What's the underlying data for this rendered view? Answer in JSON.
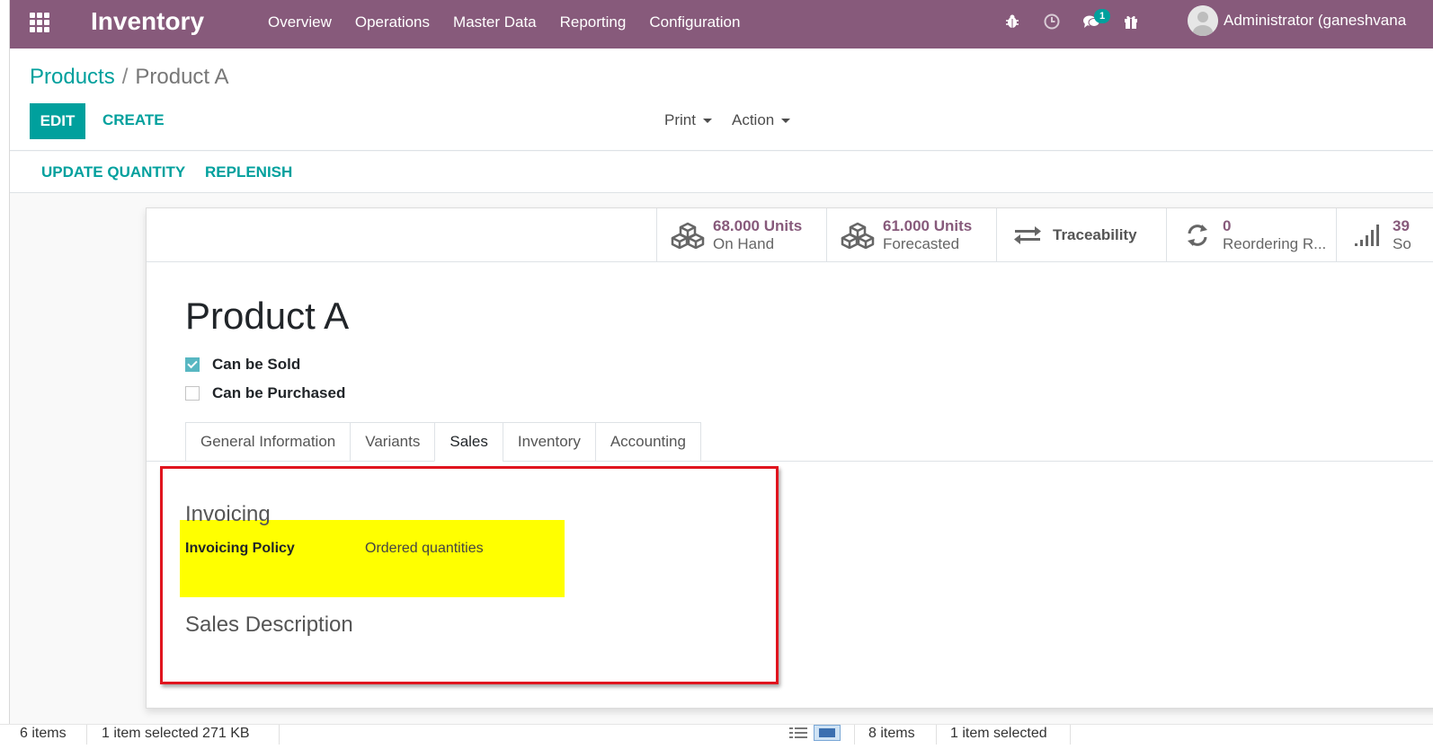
{
  "navbar": {
    "app_name": "Inventory",
    "menu": [
      "Overview",
      "Operations",
      "Master Data",
      "Reporting",
      "Configuration"
    ],
    "chat_badge": "1",
    "user_name": "Administrator (ganeshvana",
    "color": "#875a7b"
  },
  "breadcrumb": {
    "parent": "Products",
    "separator": "/",
    "current": "Product A"
  },
  "toolbar": {
    "edit_label": "EDIT",
    "create_label": "CREATE",
    "print_label": "Print",
    "action_label": "Action"
  },
  "statusbar": {
    "update_quantity_label": "UPDATE QUANTITY",
    "replenish_label": "REPLENISH"
  },
  "smart_buttons": {
    "on_hand": {
      "value": "68.000 Units",
      "label": "On Hand",
      "icon": "cubes-icon"
    },
    "forecasted": {
      "value": "61.000 Units",
      "label": "Forecasted",
      "icon": "cubes-icon"
    },
    "traceability": {
      "label": "Traceability",
      "icon": "exchange-icon"
    },
    "reordering": {
      "value": "0",
      "label": "Reordering R...",
      "icon": "refresh-icon"
    },
    "sold": {
      "value": "39",
      "label": "So",
      "icon": "signal-icon"
    }
  },
  "product": {
    "name": "Product A",
    "can_be_sold_label": "Can be Sold",
    "can_be_sold": true,
    "can_be_purchased_label": "Can be Purchased",
    "can_be_purchased": false
  },
  "tabs": [
    {
      "label": "General Information",
      "active": false
    },
    {
      "label": "Variants",
      "active": false
    },
    {
      "label": "Sales",
      "active": true
    },
    {
      "label": "Inventory",
      "active": false
    },
    {
      "label": "Accounting",
      "active": false
    }
  ],
  "sales_tab": {
    "invoicing_title": "Invoicing",
    "invoicing_policy_label": "Invoicing Policy",
    "invoicing_policy_value": "Ordered quantities",
    "sales_description_title": "Sales Description"
  },
  "annotations": {
    "highlight_color": "#ffff00",
    "box_color": "#e0141e"
  },
  "window_status": {
    "left_items": "6 items",
    "left_selected": "1 item selected  271 KB",
    "right_items": "8 items",
    "right_selected": "1 item selected"
  },
  "accent_color": "#00a09d"
}
